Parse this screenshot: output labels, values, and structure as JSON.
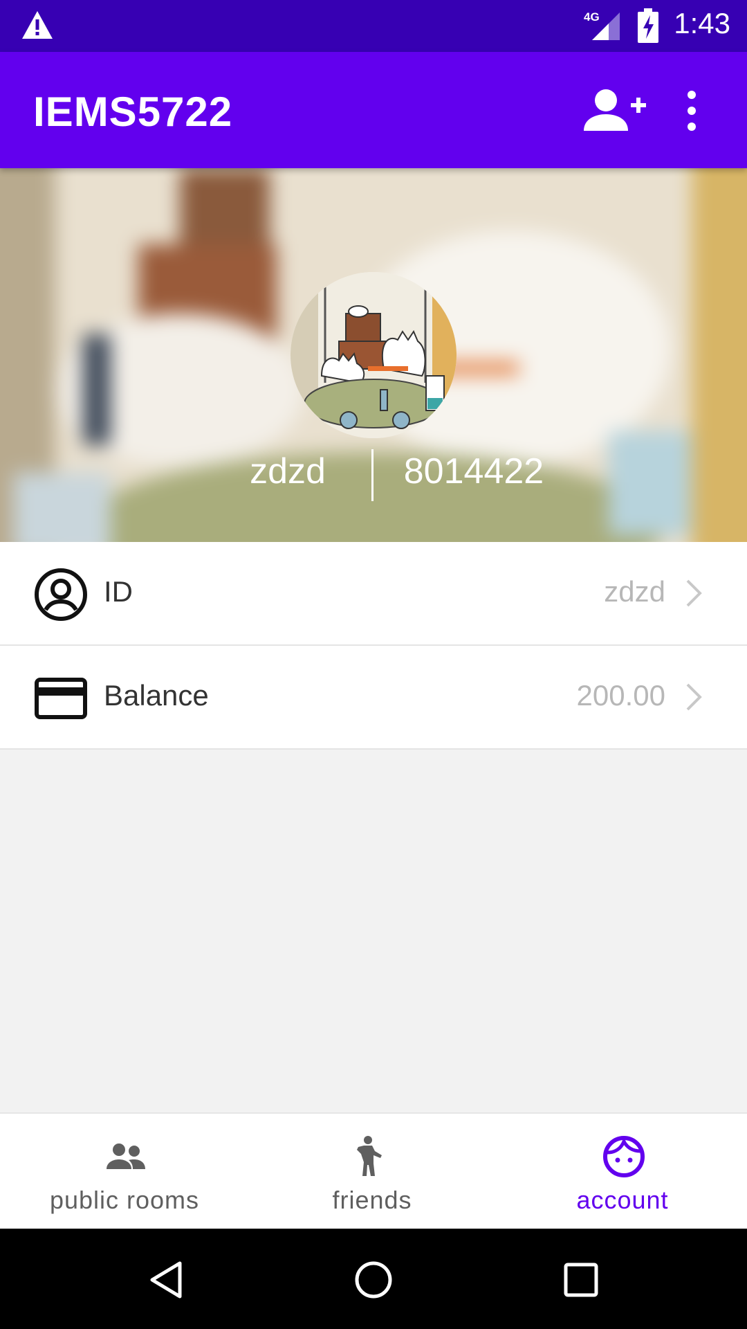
{
  "status_bar": {
    "time": "1:43",
    "network_label": "4G",
    "icons": [
      "warning-icon",
      "signal-icon",
      "battery-charging-icon"
    ]
  },
  "app_bar": {
    "title": "IEMS5722",
    "actions": [
      "add-person-icon",
      "more-vert-icon"
    ]
  },
  "profile": {
    "name": "zdzd",
    "number": "8014422"
  },
  "rows": [
    {
      "label": "ID",
      "value": "zdzd",
      "icon": "account-circle-icon"
    },
    {
      "label": "Balance",
      "value": "200.00",
      "icon": "credit-card-icon"
    }
  ],
  "bottom_nav": {
    "items": [
      {
        "label": "public rooms",
        "icon": "people-icon"
      },
      {
        "label": "friends",
        "icon": "person-waving-icon"
      },
      {
        "label": "account",
        "icon": "face-icon",
        "active": true
      }
    ]
  },
  "colors": {
    "status_bar": "#3700b3",
    "primary": "#6200ee",
    "inactive": "#5f5f5f",
    "value_text": "#b7b7b7"
  }
}
